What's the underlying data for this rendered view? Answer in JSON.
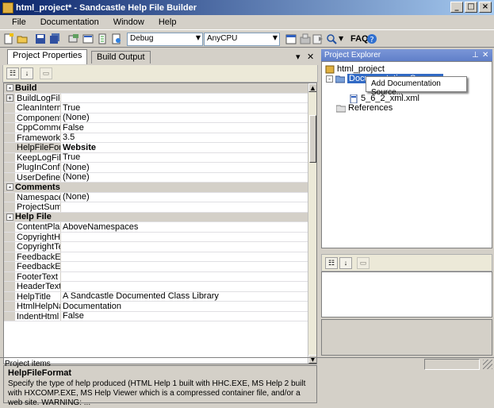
{
  "window": {
    "title": "html_project* - Sandcastle Help File Builder"
  },
  "menu": [
    "File",
    "Documentation",
    "Window",
    "Help"
  ],
  "toolbar": {
    "config": "Debug",
    "platform": "AnyCPU",
    "faq": "FAQ"
  },
  "left_pane": {
    "tabs": [
      "Project Properties",
      "Build Output"
    ],
    "pin": "▾",
    "close": "✕",
    "rows": [
      {
        "type": "cat",
        "name": "Build"
      },
      {
        "type": "prop",
        "name": "BuildLogFile",
        "value": "",
        "expand": "+"
      },
      {
        "type": "prop",
        "name": "CleanIntermediates",
        "value": "True"
      },
      {
        "type": "prop",
        "name": "ComponentConfigurations",
        "value": "(None)"
      },
      {
        "type": "prop",
        "name": "CppCommentsFixup",
        "value": "False"
      },
      {
        "type": "prop",
        "name": "FrameworkVersion",
        "value": "3.5"
      },
      {
        "type": "prop",
        "name": "HelpFileFormat",
        "value": "Website",
        "selected": true
      },
      {
        "type": "prop",
        "name": "KeepLogFile",
        "value": "True"
      },
      {
        "type": "prop",
        "name": "PlugInConfigurations",
        "value": "(None)"
      },
      {
        "type": "prop",
        "name": "UserDefinedProperties",
        "value": "(None)"
      },
      {
        "type": "cat",
        "name": "Comments"
      },
      {
        "type": "prop",
        "name": "NamespaceSummaries",
        "value": "(None)"
      },
      {
        "type": "prop",
        "name": "ProjectSummary",
        "value": ""
      },
      {
        "type": "cat",
        "name": "Help File"
      },
      {
        "type": "prop",
        "name": "ContentPlacement",
        "value": "AboveNamespaces"
      },
      {
        "type": "prop",
        "name": "CopyrightHref",
        "value": ""
      },
      {
        "type": "prop",
        "name": "CopyrightText",
        "value": ""
      },
      {
        "type": "prop",
        "name": "FeedbackEMailAddress",
        "value": ""
      },
      {
        "type": "prop",
        "name": "FeedbackEMailLinkText",
        "value": ""
      },
      {
        "type": "prop",
        "name": "FooterText",
        "value": ""
      },
      {
        "type": "prop",
        "name": "HeaderText",
        "value": ""
      },
      {
        "type": "prop",
        "name": "HelpTitle",
        "value": "A Sandcastle Documented Class Library"
      },
      {
        "type": "prop",
        "name": "HtmlHelpName",
        "value": "Documentation"
      },
      {
        "type": "prop",
        "name": "IndentHtml",
        "value": "False"
      }
    ],
    "help_title": "HelpFileFormat",
    "help_desc": "Specify the type of help produced (HTML Help 1 built with HHC.EXE, MS Help 2 built with HXCOMP.EXE, MS Help Viewer which is a compressed container file, and/or a web site.  WARNING: ..."
  },
  "right_pane": {
    "title": "Project Explorer",
    "pin": "⊥",
    "close": "✕",
    "tree": {
      "root": "html_project",
      "doc_sources": "Documentation Sources",
      "file": "5_6_2_xml.xml",
      "references": "References"
    },
    "context_menu": "Add Documentation Source..."
  },
  "status": {
    "text": "Project items"
  },
  "colors": {
    "titlebar_start": "#0a246a",
    "titlebar_end": "#a6caf0",
    "selection": "#316ac5",
    "face": "#d4d0c8"
  }
}
